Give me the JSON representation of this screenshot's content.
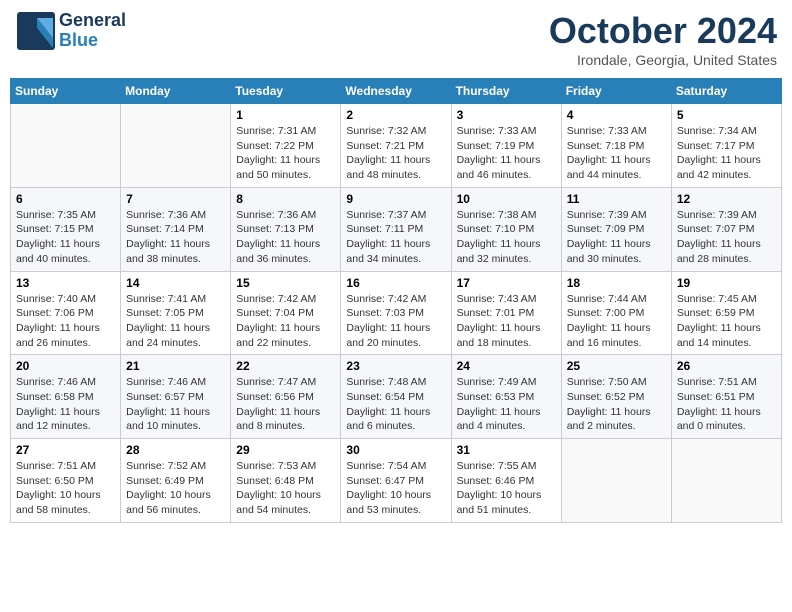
{
  "header": {
    "logo_general": "General",
    "logo_blue": "Blue",
    "month": "October 2024",
    "location": "Irondale, Georgia, United States"
  },
  "days_of_week": [
    "Sunday",
    "Monday",
    "Tuesday",
    "Wednesday",
    "Thursday",
    "Friday",
    "Saturday"
  ],
  "weeks": [
    [
      {
        "day": "",
        "info": ""
      },
      {
        "day": "",
        "info": ""
      },
      {
        "day": "1",
        "info": "Sunrise: 7:31 AM\nSunset: 7:22 PM\nDaylight: 11 hours and 50 minutes."
      },
      {
        "day": "2",
        "info": "Sunrise: 7:32 AM\nSunset: 7:21 PM\nDaylight: 11 hours and 48 minutes."
      },
      {
        "day": "3",
        "info": "Sunrise: 7:33 AM\nSunset: 7:19 PM\nDaylight: 11 hours and 46 minutes."
      },
      {
        "day": "4",
        "info": "Sunrise: 7:33 AM\nSunset: 7:18 PM\nDaylight: 11 hours and 44 minutes."
      },
      {
        "day": "5",
        "info": "Sunrise: 7:34 AM\nSunset: 7:17 PM\nDaylight: 11 hours and 42 minutes."
      }
    ],
    [
      {
        "day": "6",
        "info": "Sunrise: 7:35 AM\nSunset: 7:15 PM\nDaylight: 11 hours and 40 minutes."
      },
      {
        "day": "7",
        "info": "Sunrise: 7:36 AM\nSunset: 7:14 PM\nDaylight: 11 hours and 38 minutes."
      },
      {
        "day": "8",
        "info": "Sunrise: 7:36 AM\nSunset: 7:13 PM\nDaylight: 11 hours and 36 minutes."
      },
      {
        "day": "9",
        "info": "Sunrise: 7:37 AM\nSunset: 7:11 PM\nDaylight: 11 hours and 34 minutes."
      },
      {
        "day": "10",
        "info": "Sunrise: 7:38 AM\nSunset: 7:10 PM\nDaylight: 11 hours and 32 minutes."
      },
      {
        "day": "11",
        "info": "Sunrise: 7:39 AM\nSunset: 7:09 PM\nDaylight: 11 hours and 30 minutes."
      },
      {
        "day": "12",
        "info": "Sunrise: 7:39 AM\nSunset: 7:07 PM\nDaylight: 11 hours and 28 minutes."
      }
    ],
    [
      {
        "day": "13",
        "info": "Sunrise: 7:40 AM\nSunset: 7:06 PM\nDaylight: 11 hours and 26 minutes."
      },
      {
        "day": "14",
        "info": "Sunrise: 7:41 AM\nSunset: 7:05 PM\nDaylight: 11 hours and 24 minutes."
      },
      {
        "day": "15",
        "info": "Sunrise: 7:42 AM\nSunset: 7:04 PM\nDaylight: 11 hours and 22 minutes."
      },
      {
        "day": "16",
        "info": "Sunrise: 7:42 AM\nSunset: 7:03 PM\nDaylight: 11 hours and 20 minutes."
      },
      {
        "day": "17",
        "info": "Sunrise: 7:43 AM\nSunset: 7:01 PM\nDaylight: 11 hours and 18 minutes."
      },
      {
        "day": "18",
        "info": "Sunrise: 7:44 AM\nSunset: 7:00 PM\nDaylight: 11 hours and 16 minutes."
      },
      {
        "day": "19",
        "info": "Sunrise: 7:45 AM\nSunset: 6:59 PM\nDaylight: 11 hours and 14 minutes."
      }
    ],
    [
      {
        "day": "20",
        "info": "Sunrise: 7:46 AM\nSunset: 6:58 PM\nDaylight: 11 hours and 12 minutes."
      },
      {
        "day": "21",
        "info": "Sunrise: 7:46 AM\nSunset: 6:57 PM\nDaylight: 11 hours and 10 minutes."
      },
      {
        "day": "22",
        "info": "Sunrise: 7:47 AM\nSunset: 6:56 PM\nDaylight: 11 hours and 8 minutes."
      },
      {
        "day": "23",
        "info": "Sunrise: 7:48 AM\nSunset: 6:54 PM\nDaylight: 11 hours and 6 minutes."
      },
      {
        "day": "24",
        "info": "Sunrise: 7:49 AM\nSunset: 6:53 PM\nDaylight: 11 hours and 4 minutes."
      },
      {
        "day": "25",
        "info": "Sunrise: 7:50 AM\nSunset: 6:52 PM\nDaylight: 11 hours and 2 minutes."
      },
      {
        "day": "26",
        "info": "Sunrise: 7:51 AM\nSunset: 6:51 PM\nDaylight: 11 hours and 0 minutes."
      }
    ],
    [
      {
        "day": "27",
        "info": "Sunrise: 7:51 AM\nSunset: 6:50 PM\nDaylight: 10 hours and 58 minutes."
      },
      {
        "day": "28",
        "info": "Sunrise: 7:52 AM\nSunset: 6:49 PM\nDaylight: 10 hours and 56 minutes."
      },
      {
        "day": "29",
        "info": "Sunrise: 7:53 AM\nSunset: 6:48 PM\nDaylight: 10 hours and 54 minutes."
      },
      {
        "day": "30",
        "info": "Sunrise: 7:54 AM\nSunset: 6:47 PM\nDaylight: 10 hours and 53 minutes."
      },
      {
        "day": "31",
        "info": "Sunrise: 7:55 AM\nSunset: 6:46 PM\nDaylight: 10 hours and 51 minutes."
      },
      {
        "day": "",
        "info": ""
      },
      {
        "day": "",
        "info": ""
      }
    ]
  ]
}
